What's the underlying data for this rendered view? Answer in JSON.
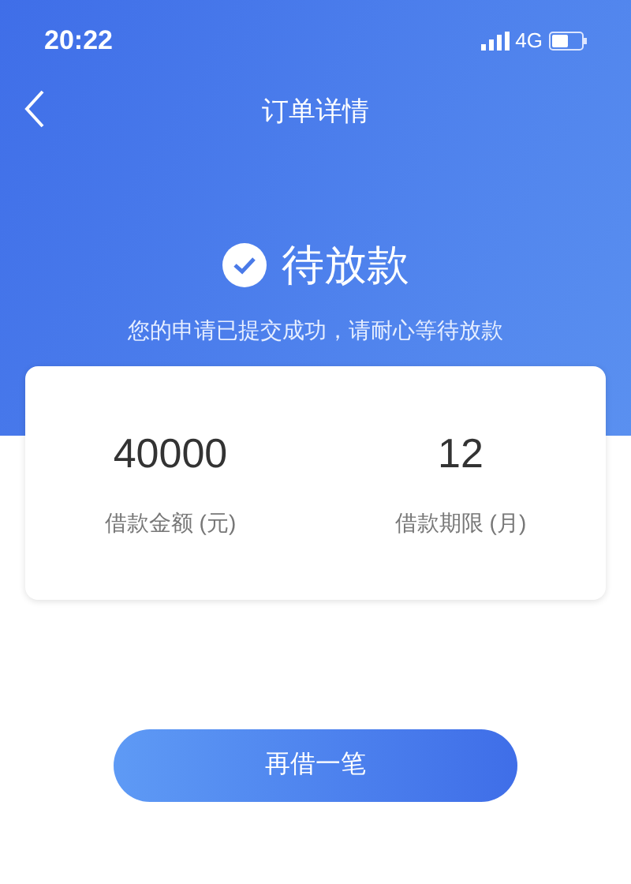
{
  "status_bar": {
    "time": "20:22",
    "network": "4G"
  },
  "nav": {
    "title": "订单详情"
  },
  "status": {
    "title": "待放款",
    "message": "您的申请已提交成功，请耐心等待放款"
  },
  "loan": [
    {
      "value": "40000",
      "label": "借款金额 (元)"
    },
    {
      "value": "12",
      "label": "借款期限 (月)"
    }
  ],
  "button": "再借一笔"
}
